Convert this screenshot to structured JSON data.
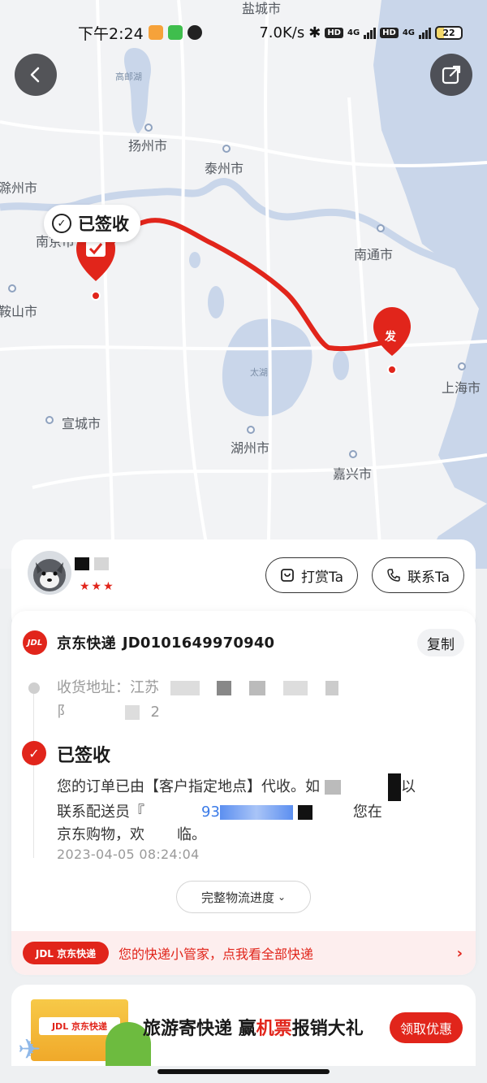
{
  "statusbar": {
    "time": "下午2:24",
    "net_speed": "7.0K/s",
    "hd1": "HD",
    "net1": "4G",
    "hd2": "HD",
    "net2": "4G",
    "battery": "22"
  },
  "map": {
    "cities": {
      "yancheng": "盐城市",
      "gaoyouhu": "高邮湖",
      "yangzhou": "扬州市",
      "taizhou": "泰州市",
      "chuzhou": "滁州市",
      "nanjing": "南京市",
      "nantong": "南通市",
      "maanshan": "鞍山市",
      "taihu": "太湖",
      "shanghai": "上海市",
      "xuancheng": "宣城市",
      "huzhou": "湖州市",
      "jiaxing": "嘉兴市"
    },
    "signed_label": "已签收",
    "origin_label": "发",
    "route_color": "#e1251b"
  },
  "courier": {
    "tip_label": "打赏Ta",
    "call_label": "联系Ta",
    "stars": "★★★"
  },
  "tracking": {
    "carrier": "京东快递",
    "tracking_no": "JD0101649970940",
    "copy_label": "复制",
    "jd_logo": "JDL",
    "addr_line1": "收货地址：江苏",
    "addr_line2a": "阝",
    "addr_line2b": "2",
    "status_title": "已签收",
    "desc_1": "您的订单已由【客户指定地点】代收。如",
    "desc_1b": "以",
    "desc_2a": "联系配送员『",
    "desc_2b": "93",
    "desc_2c": "您在",
    "desc_3": "京东购物，欢",
    "desc_3b": "临。",
    "time": "2023-04-05 08:24:04",
    "full_progress_label": "完整物流进度",
    "helper_logo": "JDL 京东快递",
    "helper_text": "您的快递小管家，点我看全部快递",
    "helper_arrow": "›"
  },
  "promo": {
    "box_label": "JDL 京东快递",
    "text_a": "旅游寄快递 赢",
    "text_hl": "机票",
    "text_b": "报销大礼",
    "button_label": "领取优惠"
  },
  "colors": {
    "accent": "#e1251b",
    "water": "#c9d6ea"
  }
}
